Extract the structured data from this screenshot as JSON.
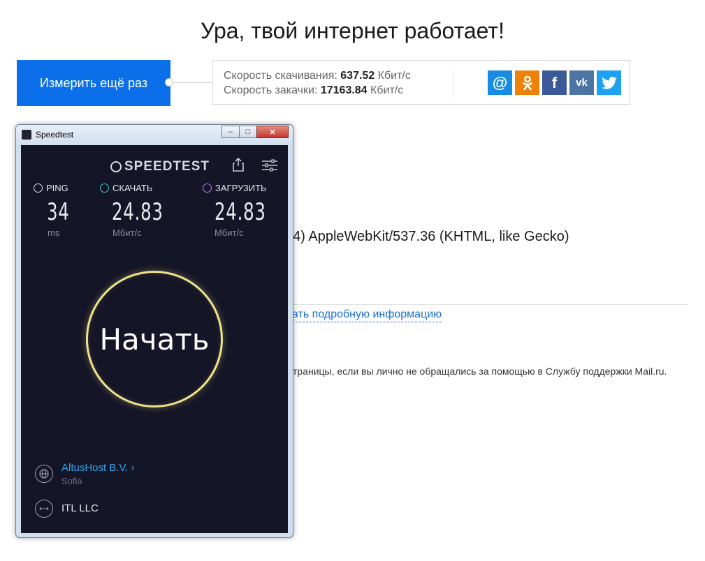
{
  "page": {
    "title": "Ура, твой интернет работает!",
    "retest_button": "Измерить ещё раз",
    "download_label": "Скорость скачивания:",
    "download_value": "637.52",
    "download_unit": "Кбит/с",
    "upload_label": "Скорость закачки:",
    "upload_value": "17163.84",
    "upload_unit": "Кбит/с",
    "share_buttons": [
      {
        "name": "mail",
        "glyph": "@",
        "color": "#168de2"
      },
      {
        "name": "ok",
        "glyph": "ок",
        "color": "#ee8208"
      },
      {
        "name": "facebook",
        "glyph": "f",
        "color": "#3b5998"
      },
      {
        "name": "vk",
        "glyph": "vk",
        "color": "#4c75a3"
      },
      {
        "name": "twitter",
        "glyph": "t",
        "color": "#1da1f2"
      }
    ],
    "user_agent_fragment": "54) AppleWebKit/537.36 (KHTML, like Gecko)",
    "detail_link": "ать подробную информацию",
    "note_fragment": "страницы, если вы лично не обращались за помощью в Службу поддержки Mail.ru."
  },
  "window": {
    "title": "Speedtest",
    "controls": [
      "–",
      "□",
      "✕"
    ]
  },
  "speedtest": {
    "logo": "SPEEDTEST",
    "ping_label": "PING",
    "ping_value": "34",
    "ping_unit": "ms",
    "download_label": "СКАЧАТЬ",
    "download_value": "24.83",
    "download_unit": "Мбит/с",
    "upload_label": "ЗАГРУЗИТЬ",
    "upload_value": "24.83",
    "upload_unit": "Мбит/с",
    "go_button": "Начать",
    "server_name": "AltusHost B.V. ›",
    "server_city": "Sofia",
    "isp_name": "ITL LLC"
  },
  "colors": {
    "accent_blue": "#0a6fe8",
    "app_bg": "#141526",
    "ring": "#efe48c",
    "server_link": "#33a5f0"
  }
}
